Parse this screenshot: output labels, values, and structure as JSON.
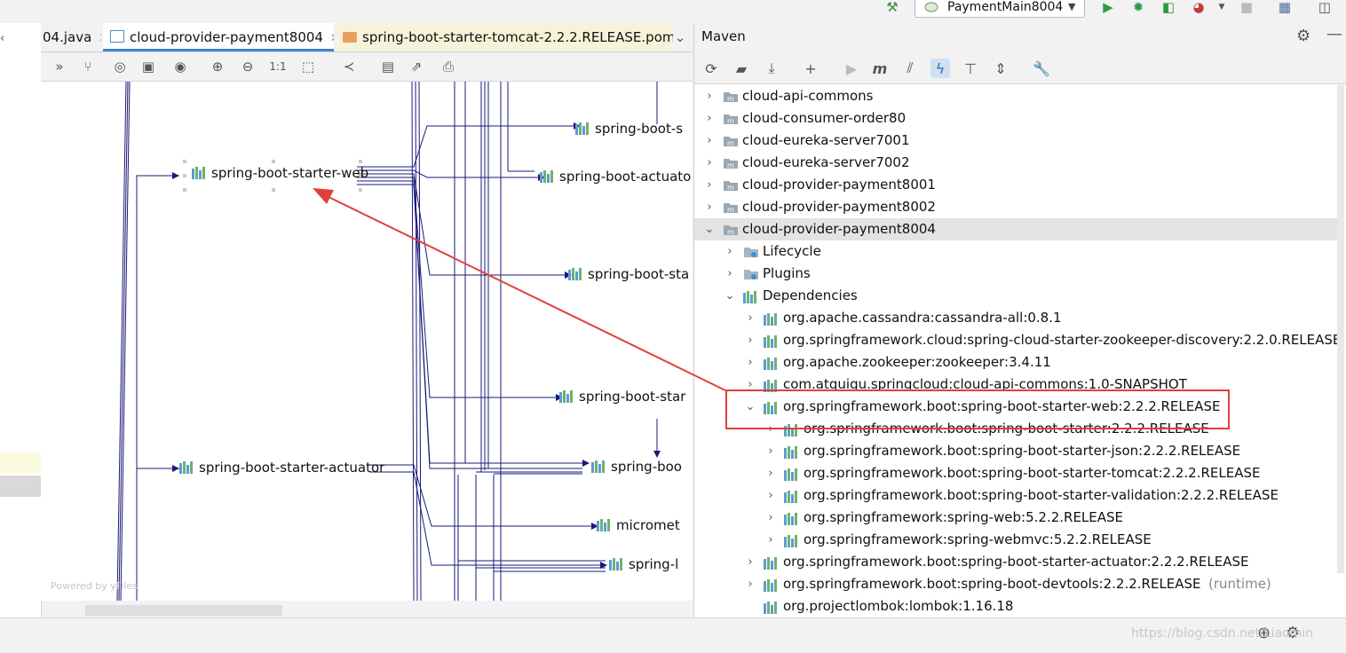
{
  "run_config": {
    "label": "PaymentMain8004"
  },
  "editor_tabs": [
    {
      "label": "04.java"
    },
    {
      "label": "cloud-provider-payment8004"
    },
    {
      "label": "spring-boot-starter-tomcat-2.2.2.RELEASE.pom"
    }
  ],
  "diagram": {
    "nodes": [
      {
        "label": "spring-boot-starter-web"
      },
      {
        "label": "spring-boot-starter-actuator"
      },
      {
        "label": "spring-boot-s"
      },
      {
        "label": "spring-boot-actuato"
      },
      {
        "label": "spring-boot-sta"
      },
      {
        "label": "spring-boot-star"
      },
      {
        "label": "spring-boo"
      },
      {
        "label": "micromet"
      },
      {
        "label": "spring-l"
      }
    ],
    "powered_by": "Powered by yFiles",
    "zoom_label": "1:1"
  },
  "maven": {
    "title": "Maven",
    "modules": [
      {
        "label": "cloud-api-commons"
      },
      {
        "label": "cloud-consumer-order80"
      },
      {
        "label": "cloud-eureka-server7001"
      },
      {
        "label": "cloud-eureka-server7002"
      },
      {
        "label": "cloud-provider-payment8001"
      },
      {
        "label": "cloud-provider-payment8002"
      },
      {
        "label": "cloud-provider-payment8004"
      }
    ],
    "sections": [
      {
        "label": "Lifecycle"
      },
      {
        "label": "Plugins"
      },
      {
        "label": "Dependencies"
      }
    ],
    "dependencies": [
      {
        "label": "org.apache.cassandra:cassandra-all:0.8.1"
      },
      {
        "label": "org.springframework.cloud:spring-cloud-starter-zookeeper-discovery:2.2.0.RELEASE"
      },
      {
        "label": "org.apache.zookeeper:zookeeper:3.4.11"
      },
      {
        "label": "com.atguigu.springcloud:cloud-api-commons:1.0-SNAPSHOT"
      },
      {
        "label": "org.springframework.boot:spring-boot-starter-web:2.2.2.RELEASE"
      },
      {
        "label": "org.springframework.boot:spring-boot-starter-actuator:2.2.2.RELEASE"
      },
      {
        "label": "org.springframework.boot:spring-boot-devtools:2.2.2.RELEASE",
        "suffix": "(runtime)"
      },
      {
        "label": "org.projectlombok:lombok:1.16.18"
      }
    ],
    "web_children": [
      {
        "label": "org.springframework.boot:spring-boot-starter:2.2.2.RELEASE"
      },
      {
        "label": "org.springframework.boot:spring-boot-starter-json:2.2.2.RELEASE"
      },
      {
        "label": "org.springframework.boot:spring-boot-starter-tomcat:2.2.2.RELEASE"
      },
      {
        "label": "org.springframework.boot:spring-boot-starter-validation:2.2.2.RELEASE"
      },
      {
        "label": "org.springframework:spring-web:5.2.2.RELEASE"
      },
      {
        "label": "org.springframework:spring-webmvc:5.2.2.RELEASE"
      }
    ]
  },
  "watermark": "https://blog.csdn.net/Liaomin",
  "colors": {
    "accent": "#4083c9",
    "arrow": "#e0403b",
    "edge": "#1a1a7a",
    "run_green": "#2e9a46"
  }
}
